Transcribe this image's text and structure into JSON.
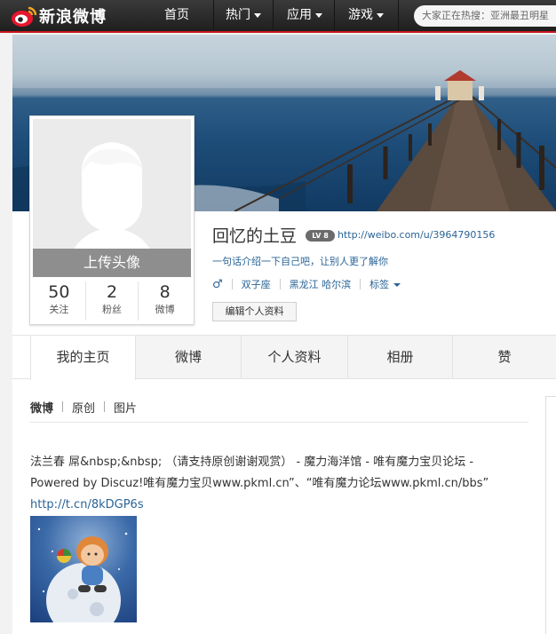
{
  "brand": {
    "name": "新浪微博"
  },
  "nav": {
    "home": "首页",
    "hot": "热门",
    "apps": "应用",
    "games": "游戏",
    "search_text": "大家正在热搜：亚洲最丑明星"
  },
  "avatar": {
    "upload_label": "上传头像"
  },
  "stats": [
    {
      "value": "50",
      "label": "关注"
    },
    {
      "value": "2",
      "label": "粉丝"
    },
    {
      "value": "8",
      "label": "微博"
    }
  ],
  "profile": {
    "username": "回忆的土豆",
    "level": "LV 8",
    "url": "http://weibo.com/u/3964790156",
    "intro": "一句话介绍一下自己吧，让别人更了解你",
    "gender_symbol": "♂",
    "zodiac": "双子座",
    "location": "黑龙江 哈尔滨",
    "tags_label": "标签",
    "edit_button": "编辑个人资料"
  },
  "tabs": [
    {
      "label": "我的主页",
      "active": true
    },
    {
      "label": "微博",
      "active": false
    },
    {
      "label": "个人资料",
      "active": false
    },
    {
      "label": "相册",
      "active": false
    },
    {
      "label": "赞",
      "active": false
    }
  ],
  "feed": {
    "subtabs": [
      {
        "label": "微博",
        "active": true
      },
      {
        "label": "原创",
        "active": false
      },
      {
        "label": "图片",
        "active": false
      }
    ],
    "post": {
      "text": "法兰春 屌&nbsp;&nbsp; （请支持原创谢谢观赏） - 魔力海洋馆 - 唯有魔力宝贝论坛 - Powered by Discuz!唯有魔力宝贝www.pkml.cn”、“唯有魔力论坛www.pkml.cn/bbs”",
      "link": "http://t.cn/8kDGP6s"
    }
  },
  "colors": {
    "accent_red": "#c8161d",
    "link_blue": "#2a6496",
    "nav_dark": "#2b2b2b"
  }
}
